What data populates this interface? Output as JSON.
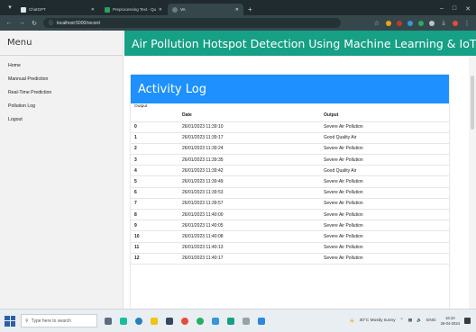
{
  "browser": {
    "tabs": [
      {
        "title": "ChatGPT",
        "color": "#1f1f1f"
      },
      {
        "title": "Preprocessing Text - QuillBot AI",
        "color": "#2e9e5b"
      },
      {
        "title": "VA",
        "color": "#6a7f85"
      }
    ],
    "url": "localhost:5000/record"
  },
  "sidebar": {
    "title": "Menu",
    "items": [
      "Home",
      "Mannual Prediction",
      "Real-Time Prediction",
      "Pollution Log",
      "Logout"
    ]
  },
  "header": {
    "title": "Air Pollution Hotspot Detection Using Machine Learning & IoT",
    "color": "#16a085"
  },
  "panel": {
    "title": "Activity Log",
    "subtitle": "Output",
    "header_color": "#1e90ff",
    "columns": [
      "",
      "Date",
      "Output"
    ],
    "rows": [
      [
        "0",
        "26/01/2023 11:39:10",
        "Severe Air Pollution"
      ],
      [
        "1",
        "26/01/2023 11:39:17",
        "Good Quality Air"
      ],
      [
        "2",
        "26/01/2023 11:39:24",
        "Severe Air Pollution"
      ],
      [
        "3",
        "26/01/2023 11:39:35",
        "Severe Air Pollution"
      ],
      [
        "4",
        "26/01/2023 11:39:42",
        "Good Quality Air"
      ],
      [
        "5",
        "26/01/2023 11:39:49",
        "Severe Air Pollution"
      ],
      [
        "6",
        "26/01/2023 11:39:53",
        "Severe Air Pollution"
      ],
      [
        "7",
        "26/01/2023 11:39:57",
        "Severe Air Pollution"
      ],
      [
        "8",
        "26/01/2023 11:40:00",
        "Severe Air Pollution"
      ],
      [
        "9",
        "26/01/2023 11:40:05",
        "Severe Air Pollution"
      ],
      [
        "10",
        "26/01/2023 11:40:08",
        "Severe Air Pollution"
      ],
      [
        "11",
        "26/01/2023 11:40:13",
        "Severe Air Pollution"
      ],
      [
        "12",
        "26/01/2023 11:40:17",
        "Severe Air Pollution"
      ]
    ]
  },
  "taskbar": {
    "search_placeholder": "Type here to search",
    "weather": "30°C  Mostly sunny",
    "lang": "ENG",
    "time": "16:10",
    "date": "25-04-2024"
  }
}
